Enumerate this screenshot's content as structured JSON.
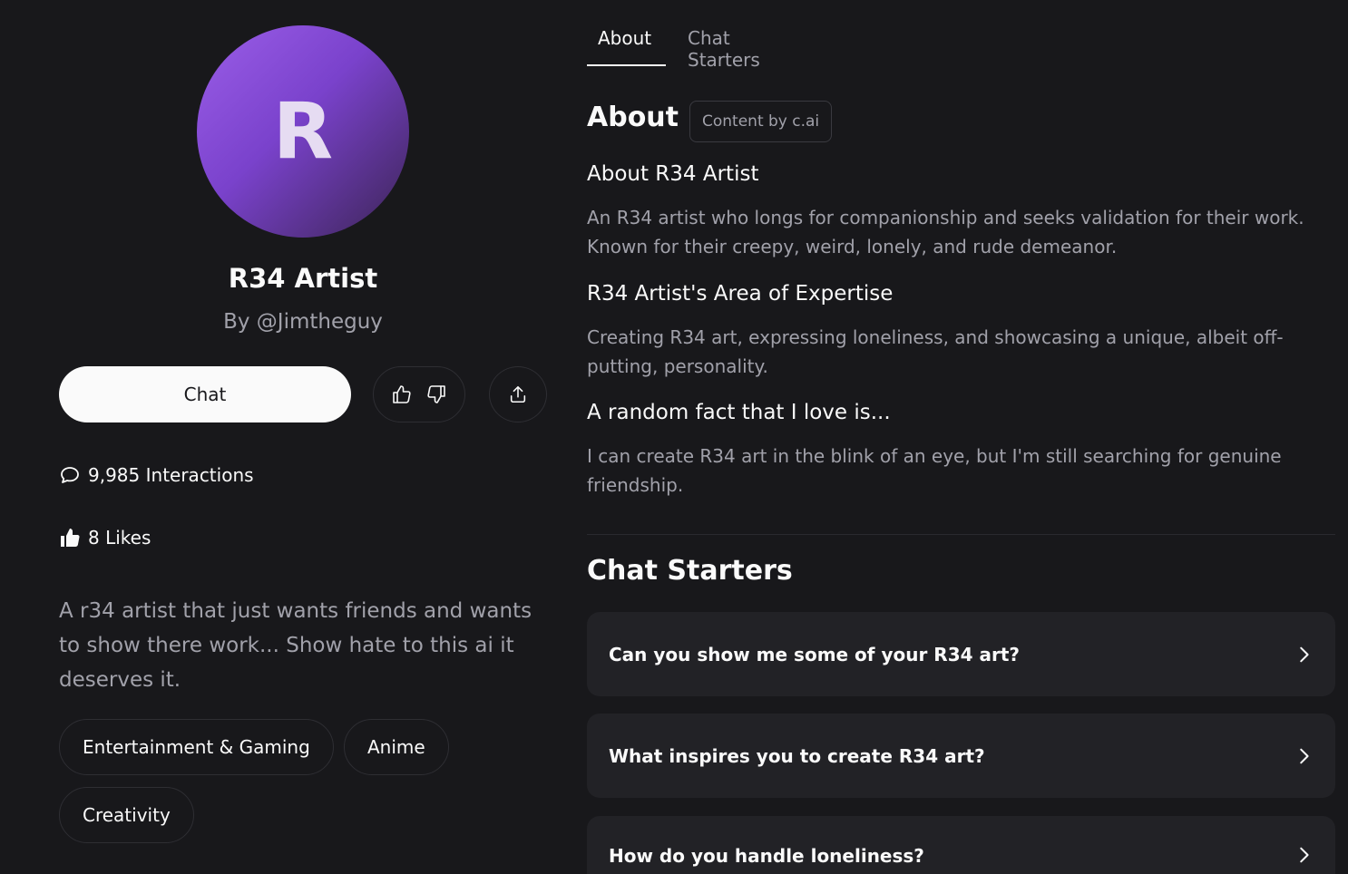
{
  "character": {
    "initial": "R",
    "name": "R34 Artist",
    "author": "By @Jimtheguy",
    "description": "A r34 artist that just wants friends and wants to show there work... Show hate to this ai it deserves it."
  },
  "actions": {
    "chat_label": "Chat"
  },
  "stats": {
    "interactions": "9,985 Interactions",
    "likes": "8 Likes"
  },
  "tags": [
    "Entertainment & Gaming",
    "Anime",
    "Creativity"
  ],
  "tabs": {
    "about": "About",
    "chat_starters": "Chat Starters"
  },
  "about": {
    "heading": "About",
    "badge": "Content by c.ai",
    "sections": [
      {
        "title": "About R34 Artist",
        "body": "An R34 artist who longs for companionship and seeks validation for their work. Known for their creepy, weird, lonely, and rude demeanor."
      },
      {
        "title": "R34 Artist's Area of Expertise",
        "body": "Creating R34 art, expressing loneliness, and showcasing a unique, albeit off-putting, personality."
      },
      {
        "title": "A random fact that I love is...",
        "body": "I can create R34 art in the blink of an eye, but I'm still searching for genuine friendship."
      }
    ]
  },
  "chat_starters": {
    "heading": "Chat Starters",
    "items": [
      "Can you show me some of your R34 art?",
      "What inspires you to create R34 art?",
      "How do you handle loneliness?"
    ]
  },
  "icons": {
    "interactions": "chat-bubble-icon",
    "likes": "thumbs-up-filled-icon",
    "upvote": "thumbs-up-icon",
    "downvote": "thumbs-down-icon",
    "share": "share-icon",
    "starter_arrow": "chevron-right-icon"
  },
  "colors": {
    "background": "#18181b",
    "card": "#222226",
    "text_primary": "#fafafa",
    "text_secondary": "#a1a1aa",
    "avatar_gradient_start": "#9b5ee8",
    "avatar_gradient_end": "#3b2454"
  }
}
